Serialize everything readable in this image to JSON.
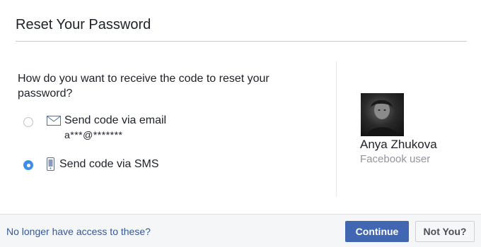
{
  "dialog": {
    "title": "Reset Your Password",
    "question": "How do you want to receive the code to reset your password?"
  },
  "options": [
    {
      "label": "Send code via email",
      "sub": "a***@*******",
      "icon": "envelope-icon",
      "selected": false
    },
    {
      "label": "Send code via SMS",
      "icon": "phone-icon",
      "selected": true
    }
  ],
  "user": {
    "name": "Anya Zhukova",
    "subtitle": "Facebook user"
  },
  "footer": {
    "link_text": "No longer have access to these?",
    "continue_label": "Continue",
    "not_you_label": "Not You?"
  },
  "colors": {
    "primary_button": "#4267b2",
    "link": "#365899",
    "radio_selected": "#3d8fe8"
  }
}
